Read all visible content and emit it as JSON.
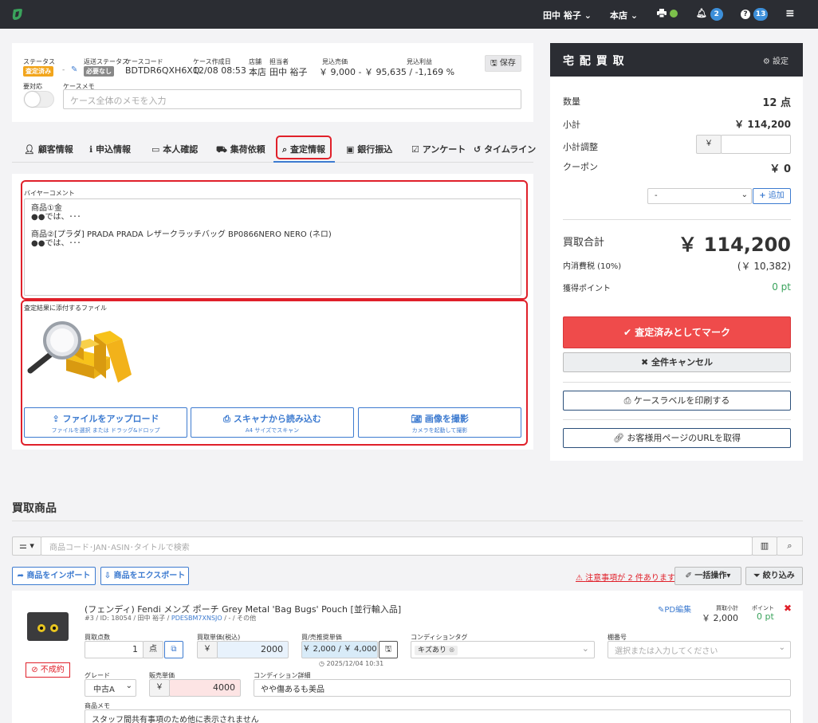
{
  "topbar": {
    "user": "田中 裕子",
    "store": "本店",
    "notif_count": "2",
    "help_count": "13"
  },
  "case": {
    "status_label": "ステータス",
    "status_value": "査定済み",
    "ship_status_label": "返送ステータス",
    "ship_status_value": "必要なし",
    "code_label": "ケースコード",
    "code_value": "BDTDR6QXH6XQ",
    "created_label": "ケース作成日",
    "created_value": "12/08 08:53",
    "store_label": "店舗",
    "store_value": "本店",
    "staff_label": "担当者",
    "staff_value": "田中 裕子",
    "est_sales_label": "見込売価",
    "est_sales_value": "￥ 9,000 - ￥ 95,635 / -1,169 %",
    "est_profit_label": "見込利益",
    "save_label": "保存",
    "needs_action_label": "要対応",
    "memo_label": "ケースメモ",
    "memo_placeholder": "ケース全体のメモを入力"
  },
  "tabs": [
    {
      "icon": "user-icon",
      "label": "顧客情報"
    },
    {
      "icon": "info-icon",
      "label": "申込情報"
    },
    {
      "icon": "id-card-icon",
      "label": "本人確認"
    },
    {
      "icon": "truck-icon",
      "label": "集荷依頼"
    },
    {
      "icon": "search-icon",
      "label": "査定情報"
    },
    {
      "icon": "bank-icon",
      "label": "銀行振込"
    },
    {
      "icon": "check-square-icon",
      "label": "アンケート"
    },
    {
      "icon": "history-icon",
      "label": "タイムライン"
    }
  ],
  "assessment": {
    "buyer_comment_label": "バイヤーコメント",
    "comment_lines": [
      "商品①金",
      "●●では、･･･",
      "",
      "商品②[プラダ] PRADA PRADA レザークラッチバッグ BP0866NERO NERO (ネロ)",
      "●●では、･･･"
    ],
    "attach_label": "査定結果に添付するファイル",
    "upload_label": "ファイルをアップロード",
    "upload_sub": "ファイルを選択 または ドラッグ&ドロップ",
    "scan_label": "スキャナから読み込む",
    "scan_sub": "A4 サイズでスキャン",
    "photo_label": "画像を撮影",
    "photo_sub": "カメラを起動して撮影"
  },
  "side": {
    "title": "宅 配 買 取",
    "settings_label": "設定",
    "qty_label": "数量",
    "qty_value": "12 点",
    "subtotal_label": "小計",
    "subtotal_value": "￥ 114,200",
    "adjust_label": "小計調整",
    "yen": "￥",
    "coupon_label": "クーポン",
    "coupon_value": "￥ 0",
    "coupon_select": "-",
    "add_label": "追加",
    "total_label": "買取合計",
    "total_value": "￥ 114,200",
    "tax_label": "内消費税 (10%)",
    "tax_value": "(￥ 10,382)",
    "points_label": "獲得ポイント",
    "points_value": "0 pt",
    "mark_label": "査定済みとしてマーク",
    "cancel_label": "全件キャンセル",
    "print_label": "ケースラベルを印刷する",
    "url_label": "お客様用ページのURLを取得"
  },
  "products": {
    "heading": "買取商品",
    "search_placeholder": "商品コード･JAN･ASIN･タイトルで検索",
    "import_label": "商品をインポート",
    "export_label": "商品をエクスポート",
    "warning_label": "注意事項が 2 件あります",
    "bulk_label": "一括操作",
    "filter_label": "絞り込み",
    "item": {
      "title": "(フェンディ) Fendi メンズ ポーチ Grey Metal 'Bag Bugs' Pouch [並行輸入品]",
      "meta_prefix": "#3 / ID: 18054 / 田中 裕子 / ",
      "meta_link": "PDESBM7XNSJO",
      "meta_suffix": " / - / その他",
      "pd_edit": "PD編集",
      "subtotal_label": "買取小計",
      "subtotal_value": "￥ 2,000",
      "point_label": "ポイント",
      "point_value": "0 pt",
      "status_label": "不成約",
      "qty_label": "買取点数",
      "qty_value": "1",
      "qty_unit": "点",
      "price_label": "買取単価(税込)",
      "price_value": "2000",
      "ref_label": "買/売推奨単価",
      "ref_value": "￥ 2,000 / ￥ 4,000",
      "ref_date": "2025/12/04 10:31",
      "cond_tag_label": "コンディションタグ",
      "cond_tag_value": "キズあり",
      "shelf_label": "棚番号",
      "shelf_placeholder": "選択または入力してください",
      "grade_label": "グレード",
      "grade_value": "中古A",
      "sale_label": "販売単価",
      "sale_value": "4000",
      "cond_detail_label": "コンディション詳細",
      "cond_detail_value": "やや傷あるも美品",
      "memo_label": "商品メモ",
      "memo_value": "スタッフ間共有事項のため他に表示されません"
    }
  }
}
